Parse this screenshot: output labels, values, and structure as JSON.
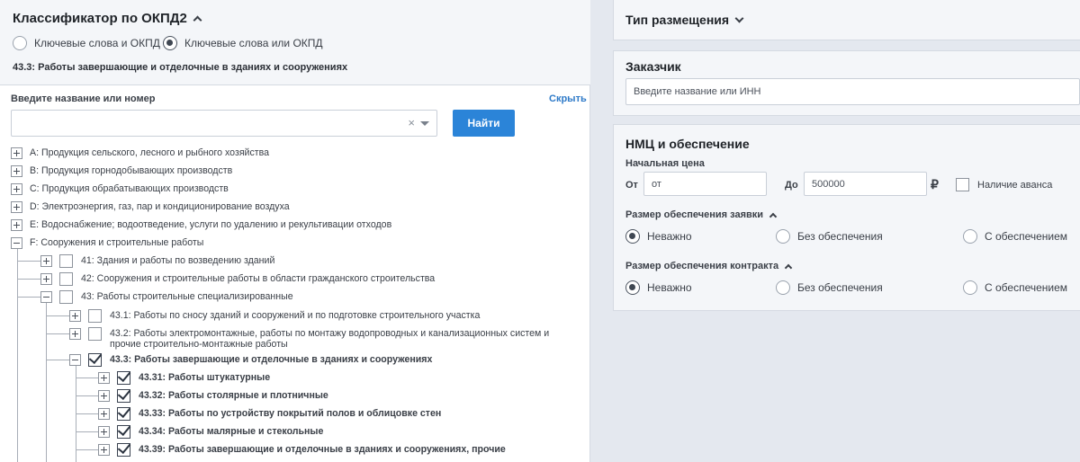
{
  "okpd": {
    "title": "Классификатор по ОКПД2",
    "radio_and": "Ключевые слова и ОКПД",
    "radio_or": "Ключевые слова или ОКПД",
    "selected": "43.3: Работы завершающие и отделочные в зданиях и сооружениях"
  },
  "search": {
    "label": "Введите название или номер",
    "hide": "Скрыть",
    "value": "",
    "clear_glyph": "×",
    "find_button": "Найти"
  },
  "tree": {
    "a": "A: Продукция сельского, лесного и рыбного хозяйства",
    "b": "B: Продукция горнодобывающих производств",
    "c": "C: Продукция обрабатывающих производств",
    "d": "D: Электроэнергия, газ, пар и кондиционирование воздуха",
    "e": "E: Водоснабжение; водоотведение, услуги по удалению и рекультивации отходов",
    "f": "F: Сооружения и строительные работы",
    "f41": "41: Здания и работы по возведению зданий",
    "f42": "42: Сооружения и строительные работы в области гражданского строительства",
    "f43": "43: Работы строительные специализированные",
    "f431": "43.1: Работы по сносу зданий и сооружений и по подготовке строительного участка",
    "f432_line1": "43.2: Работы электромонтажные, работы по монтажу водопроводных и канализационных систем и",
    "f432_line2": "прочие строительно-монтажные работы",
    "f433": "43.3: Работы завершающие и отделочные в зданиях и сооружениях",
    "f4331": "43.31: Работы штукатурные",
    "f4332": "43.32: Работы столярные и плотничные",
    "f4333": "43.33: Работы по устройству покрытий полов и облицовке стен",
    "f4334": "43.34: Работы малярные и стекольные",
    "f4339": "43.39: Работы завершающие и отделочные в зданиях и сооружениях, прочие"
  },
  "placement": {
    "title": "Тип размещения"
  },
  "customer": {
    "title": "Заказчик",
    "placeholder": "Введите название или ИНН"
  },
  "nmc": {
    "title": "НМЦ и обеспечение",
    "price_label": "Начальная цена",
    "from_label": "От",
    "from_value": "от",
    "to_label": "До",
    "to_value": "500000",
    "currency": "₽",
    "advance_label": "Наличие аванса",
    "bid_security_title": "Размер обеспечения заявки",
    "contract_security_title": "Размер обеспечения контракта",
    "opt_any": "Неважно",
    "opt_without": "Без обеспечения",
    "opt_with": "С обеспечением"
  }
}
